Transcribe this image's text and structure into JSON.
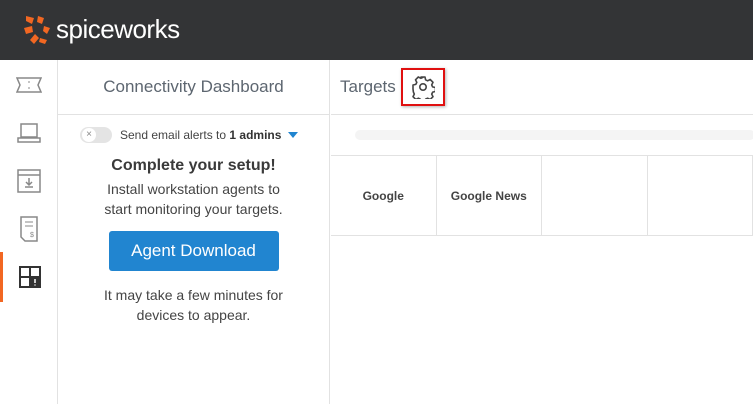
{
  "header": {
    "brand": "spiceworks",
    "logo_color": "#f26722"
  },
  "sidebar": {
    "items": [
      {
        "icon": "ticket-icon"
      },
      {
        "icon": "laptop-icon"
      },
      {
        "icon": "download-icon"
      },
      {
        "icon": "invoice-icon"
      },
      {
        "icon": "dashboard-alert-icon",
        "active": true
      }
    ]
  },
  "panel": {
    "title": "Connectivity Dashboard",
    "alerts": {
      "prefix": "Send email alerts to",
      "count": "1 admins",
      "toggle_icon": "×"
    },
    "setup": {
      "heading": "Complete your setup!",
      "line1": "Install workstation agents to",
      "line2": "start monitoring your targets.",
      "button": "Agent Download",
      "note1": "It may take a few minutes for",
      "note2": "devices to appear."
    }
  },
  "targets": {
    "title": "Targets",
    "items": [
      "Google",
      "Google News",
      "",
      ""
    ]
  }
}
